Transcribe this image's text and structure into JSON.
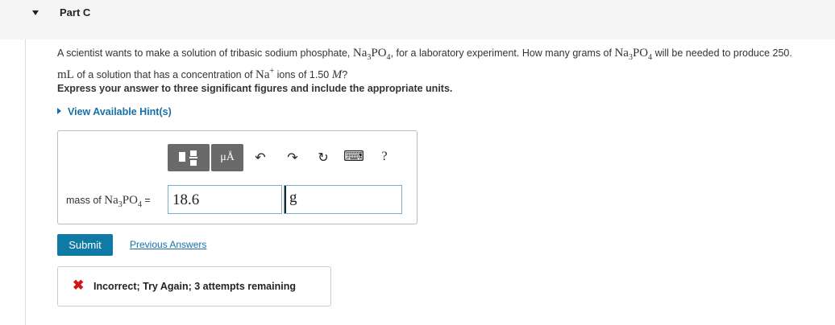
{
  "part": {
    "title": "Part C"
  },
  "question": {
    "text1": "A scientist wants to make a solution of tribasic sodium phosphate, ",
    "formula": "Na3PO4",
    "text2": ", for a laboratory experiment. How many grams of ",
    "text3": " will be needed to produce 250.",
    "unit_ml": "mL",
    "text4": " of a solution that has a concentration of ",
    "ion": "Na+",
    "text5": " ions of 1.50 ",
    "molar": "M",
    "text6": "?"
  },
  "instruction": "Express your answer to three significant figures and include the appropriate units.",
  "hint": {
    "label": "View Available Hint(s)"
  },
  "toolbar": {
    "units_button": "μÅ",
    "undo": "↶",
    "redo": "↷",
    "reset": "↻",
    "keyboard": "⌨",
    "help": "?"
  },
  "answer": {
    "label_prefix": "mass of ",
    "label_formula": "Na3PO4",
    "label_suffix": " =",
    "value": "18.6",
    "unit": "g"
  },
  "actions": {
    "submit": "Submit",
    "previous": "Previous Answers"
  },
  "feedback": {
    "icon": "✖",
    "message": "Incorrect; Try Again; 3 attempts remaining"
  },
  "colors": {
    "accent": "#0f7aa5",
    "link": "#1670a8",
    "error": "#d01616"
  }
}
